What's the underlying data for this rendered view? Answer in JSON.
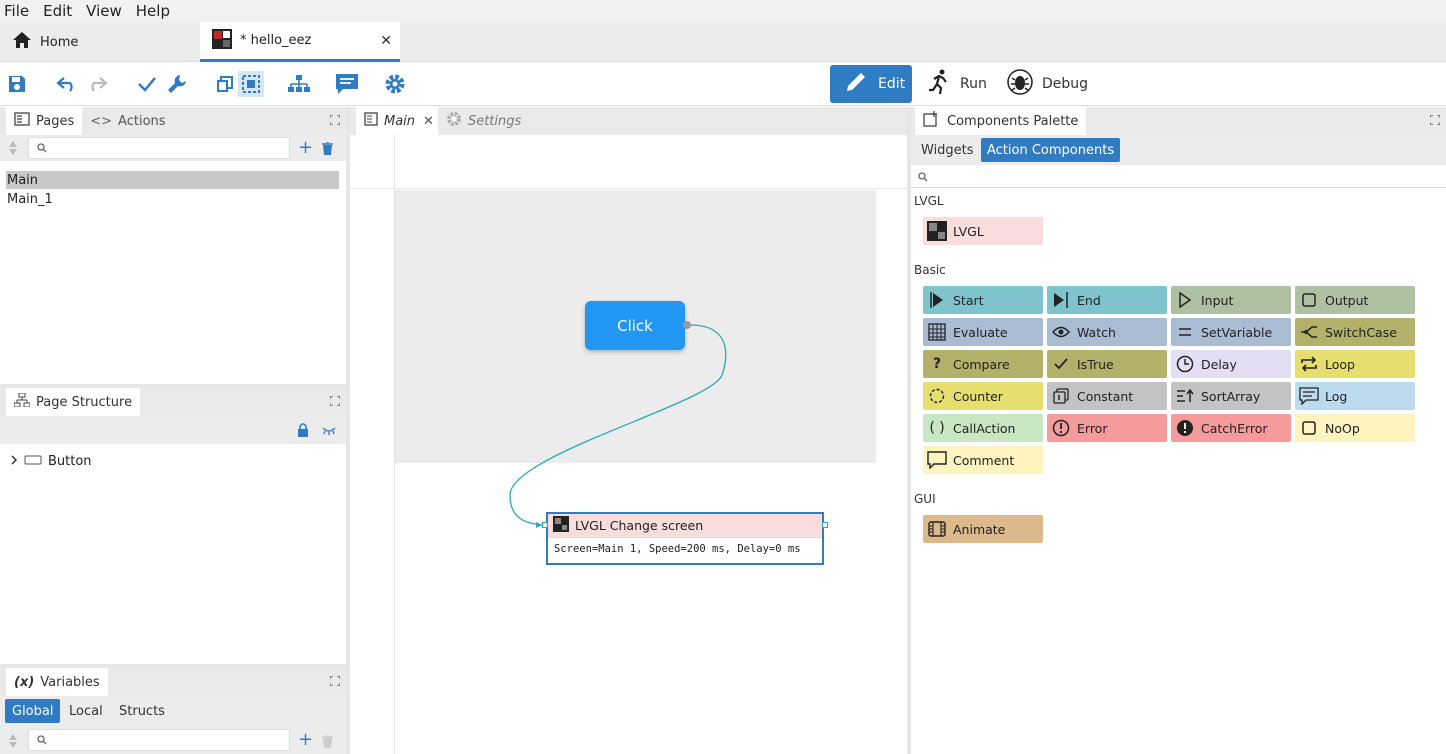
{
  "menu": [
    "File",
    "Edit",
    "View",
    "Help"
  ],
  "tabs": {
    "home": "Home",
    "project": "* hello_eez"
  },
  "modes": {
    "edit": "Edit",
    "run": "Run",
    "debug": "Debug"
  },
  "pages_panel": {
    "tab_pages": "Pages",
    "tab_actions": "Actions",
    "items": [
      "Main",
      "Main_1"
    ]
  },
  "structure_panel": {
    "title": "Page Structure",
    "item": "Button"
  },
  "variables_panel": {
    "title": "Variables",
    "tabs": [
      "Global",
      "Local",
      "Structs"
    ]
  },
  "editor_tabs": {
    "main": "Main",
    "settings": "Settings"
  },
  "canvas": {
    "button_label": "Click",
    "node_title": "LVGL Change screen",
    "node_body": "Screen=Main 1, Speed=200 ms, Delay=0 ms"
  },
  "palette": {
    "title": "Components Palette",
    "tabs": [
      "Widgets",
      "Action Components"
    ],
    "groups": {
      "lvgl": "LVGL",
      "basic": "Basic",
      "gui": "GUI"
    },
    "lvgl": [
      "LVGL"
    ],
    "basic": [
      "Start",
      "End",
      "Input",
      "Output",
      "Evaluate",
      "Watch",
      "SetVariable",
      "SwitchCase",
      "Compare",
      "IsTrue",
      "Delay",
      "Loop",
      "Counter",
      "Constant",
      "SortArray",
      "Log",
      "CallAction",
      "Error",
      "CatchError",
      "NoOp",
      "Comment"
    ],
    "gui": [
      "Animate"
    ]
  },
  "colors": {
    "accent": "#2f7cc2",
    "lvgl": "#f9dcdc",
    "start": "#7fc4cc",
    "input": "#aec0a2",
    "evaluate": "#a9bcd2",
    "switch": "#b3b169",
    "compare": "#b3b169",
    "delay": "#e3def3",
    "counter": "#e6df6f",
    "constant": "#c3c3c3",
    "log": "#bddbee",
    "callaction": "#c8e6c2",
    "error": "#f69b9b",
    "noop": "#fff3c0",
    "animate": "#ddb88a"
  }
}
